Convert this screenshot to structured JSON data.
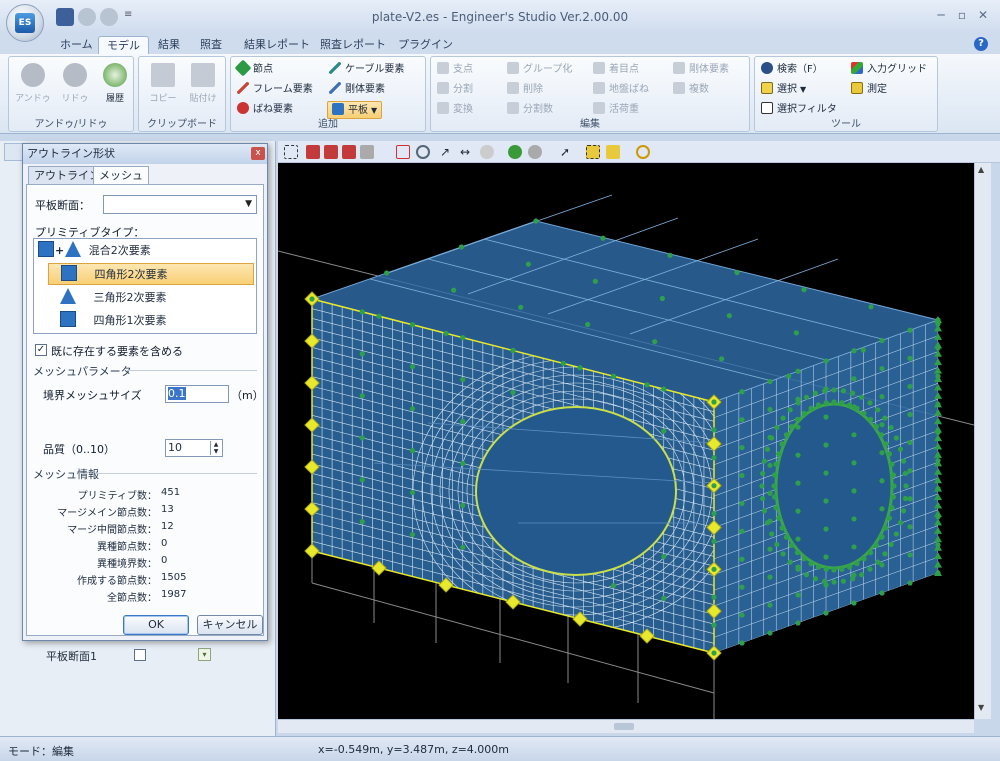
{
  "window": {
    "title": "plate-V2.es - Engineer's Studio Ver.2.00.00",
    "logo_text": "ES",
    "qat_menu": "≡",
    "minimize": "─",
    "maximize": "▫",
    "close": "✕"
  },
  "ribbon": {
    "tabs": [
      "ホーム",
      "モデル",
      "結果",
      "照査",
      "結果レポート",
      "照査レポート",
      "プラグイン"
    ],
    "active_tab": "モデル",
    "help": "?",
    "groups": {
      "undo": {
        "label": "アンドゥ/リドゥ",
        "undo": "アンドゥ",
        "redo": "リドゥ",
        "history": "履歴"
      },
      "clipboard": {
        "label": "クリップボード",
        "copy": "コピー",
        "paste": "貼付け"
      },
      "add": {
        "label": "追加",
        "node": "節点",
        "frame": "フレーム要素",
        "spring": "ばね要素",
        "cable": "ケーブル要素",
        "rigid": "剛体要素",
        "plate": "平板"
      },
      "edit": {
        "label": "編集",
        "fulcrum": "支点",
        "split": "分割",
        "transform": "変換",
        "group": "グループ化",
        "delete": "削除",
        "split_count": "分割数",
        "mesh_point": "着目点",
        "ground_spring": "地盤ばね",
        "live_load": "活荷重",
        "rigid_elem": "剛体要素",
        "multiple": "複数"
      },
      "tools": {
        "label": "ツール",
        "search": "検索（F）",
        "select": "選択",
        "select_filter": "選択フィルタ",
        "input_grid": "入力グリッド",
        "measure": "測定"
      }
    }
  },
  "dialog": {
    "title": "アウトライン形状",
    "close": "x",
    "tabs": [
      "アウトライン",
      "メッシュ"
    ],
    "active_tab": "メッシュ",
    "plate_section_label": "平板断面：",
    "plate_section_value": "",
    "primitive_type_label": "プリミティブタイプ：",
    "primitives": [
      "混合2次要素",
      "四角形2次要素",
      "三角形2次要素",
      "四角形1次要素"
    ],
    "selected_primitive": "四角形2次要素",
    "include_existing_label": "既に存在する要素を含める",
    "include_existing_checked": "✓",
    "mesh_params_label": "メッシュパラメータ",
    "boundary_mesh_size_label": "境界メッシュサイズ",
    "boundary_mesh_size_value": "0.1",
    "boundary_mesh_size_unit": "（m）",
    "quality_label": "品質（0..10）",
    "quality_value": "10",
    "mesh_info_label": "メッシュ情報",
    "info": [
      {
        "label": "プリミティブ数：",
        "value": "451"
      },
      {
        "label": "マージメイン節点数：",
        "value": "13"
      },
      {
        "label": "マージ中間節点数：",
        "value": "12"
      },
      {
        "label": "異種節点数：",
        "value": "0"
      },
      {
        "label": "異種境界数：",
        "value": "0"
      },
      {
        "label": "作成する節点数：",
        "value": "1505"
      },
      {
        "label": "全節点数：",
        "value": "1987"
      }
    ],
    "ok": "OK",
    "cancel": "キャンセル"
  },
  "left_pane": {
    "plate_section_item": "平板断面1",
    "dropdown": "▾"
  },
  "status": {
    "mode": "モード：編集",
    "coords": "x=-0.549m, y=3.487m, z=4.000m"
  },
  "colors": {
    "viewport_bg": "#000000",
    "mesh_fill": "#2f6ea8",
    "mesh_line": "#ffffff",
    "node_green": "#2fa04a",
    "boundary_yellow": "#e8e82c"
  }
}
